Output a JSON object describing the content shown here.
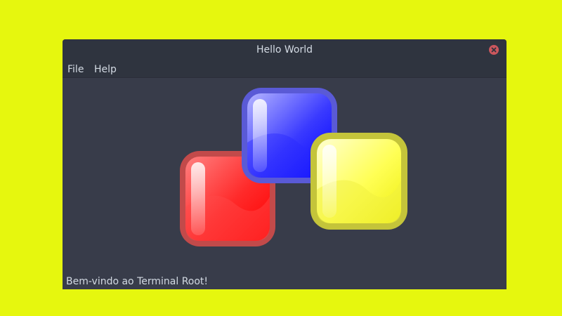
{
  "window": {
    "title": "Hello World"
  },
  "menu": {
    "items": [
      {
        "label": "File"
      },
      {
        "label": "Help"
      }
    ]
  },
  "logo": {
    "icon": "three-squares-logo-icon",
    "colors": {
      "red": "#ff1a1a",
      "blue": "#2020ff",
      "yellow": "#f5f020"
    }
  },
  "status": {
    "text": "Bem-vindo ao Terminal Root!"
  },
  "colors": {
    "desktop_background": "#e6f70e",
    "window_background": "#383c4a",
    "titlebar_background": "#2f343f",
    "text": "#d3dae3",
    "close_button": "#cc575d"
  }
}
